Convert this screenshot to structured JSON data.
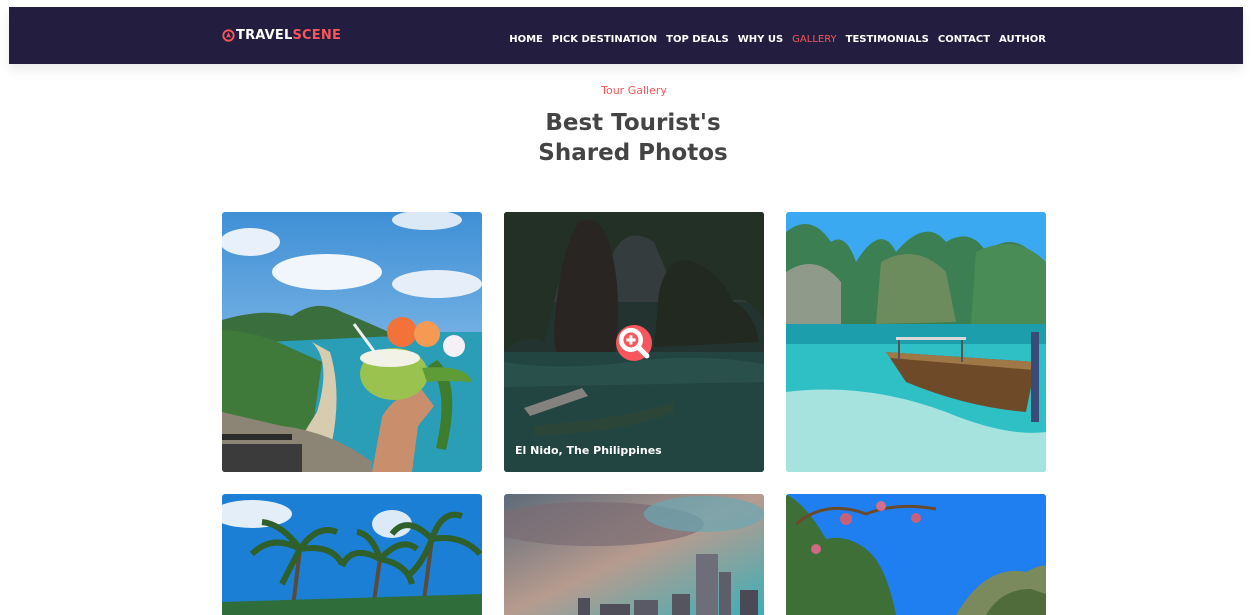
{
  "brand": {
    "part1": "TRAVEL",
    "part2": "SCENE",
    "icon": "location-pin-icon"
  },
  "nav": {
    "items": [
      "HOME",
      "PICK DESTINATION",
      "TOP DEALS",
      "WHY US",
      "GALLERY",
      "TESTIMONIALS",
      "CONTACT",
      "AUTHOR"
    ],
    "active": "GALLERY"
  },
  "gallery": {
    "subtitle": "Tour Gallery",
    "title": "Best Tourist's Shared Photos",
    "hover_caption": "El Nido, The Philippines",
    "zoom_icon": "zoom-in-icon"
  },
  "colors": {
    "accent": "#f7565c",
    "navbar": "#231d3f",
    "heading": "#444444"
  }
}
